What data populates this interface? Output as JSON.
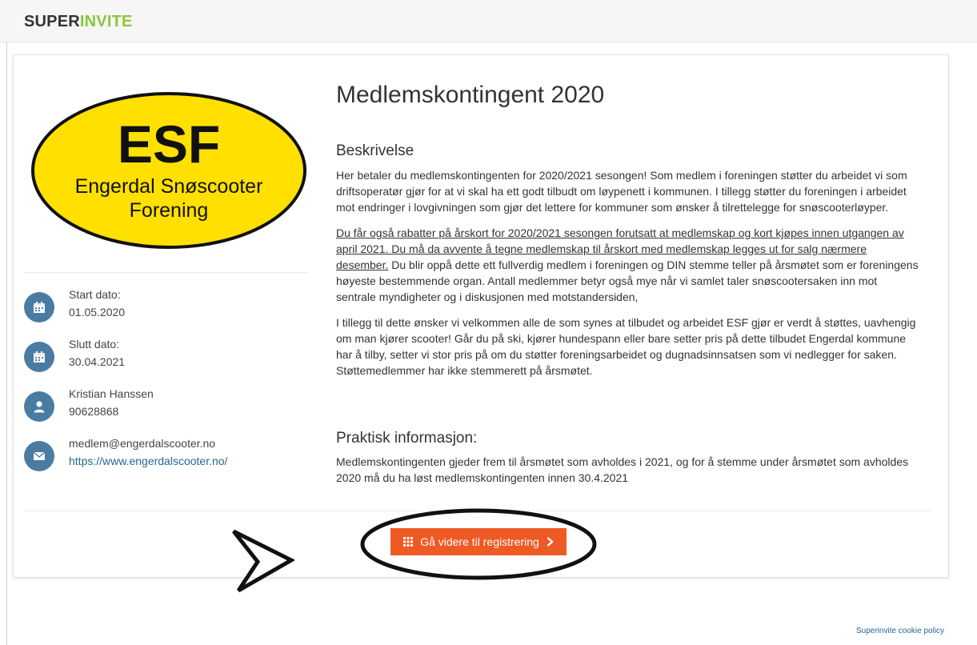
{
  "header": {
    "logo_part1": "SUPER",
    "logo_part2": "INVITE"
  },
  "colors": {
    "brand_green": "#8cc63f",
    "button_orange": "#ee5a24",
    "icon_blue": "#4a7ca3",
    "logo_yellow": "#ffe000"
  },
  "club_logo": {
    "abbr": "ESF",
    "line1": "Engerdal Snøscooter",
    "line2": "Forening"
  },
  "sidebar": {
    "start": {
      "label": "Start dato:",
      "value": "01.05.2020",
      "icon": "calendar-icon"
    },
    "end": {
      "label": "Slutt dato:",
      "value": "30.04.2021",
      "icon": "calendar-icon"
    },
    "contact": {
      "name": "Kristian Hanssen",
      "phone": "90628868",
      "icon": "user-icon"
    },
    "email": {
      "address": "medlem@engerdalscooter.no",
      "website": "https://www.engerdalscooter.no/",
      "icon": "envelope-icon"
    }
  },
  "main": {
    "title": "Medlemskontingent 2020",
    "description_heading": "Beskrivelse",
    "para1": [
      "Her betaler du medlemskontingenten for 2020/2021 sesongen! Som medlem i foreningen støtter du arbeidet vi som",
      "driftsoperatør gjør for at vi skal ha ett godt tilbudt om løypenett i kommunen. I tillegg støtter du foreningen i arbeidet",
      "mot endringer i lovgivningen som gjør det lettere for kommuner som ønsker å tilrettelegge  for snøscooterløyper."
    ],
    "para2_underlined": [
      "Du får også rabatter på årskort for 2020/2021 sesongen forutsatt at medlemskap og kort kjøpes innen utgangen av",
      "april 2021. Du må da avvente å tegne medlemskap til årskort med medlemskap legges ut for salg nærmere",
      "desember."
    ],
    "para2_rest": [
      " Du blir oppå dette ett fullverdig medlem i foreningen og DIN stemme teller på årsmøtet som er foreningens",
      "høyeste bestemmende organ. Antall medlemmer betyr også mye når vi samlet taler snøscootersaken inn mot",
      "sentrale myndigheter og i diskusjonen med motstandersiden,"
    ],
    "para3": [
      "I tillegg til dette ønsker vi velkommen alle de som synes at tilbudet og arbeidet ESF gjør er verdt å støttes, uavhengig",
      "om man kjører scooter! Går du på ski, kjører hundespann eller bare setter pris på dette tilbudet Engerdal kommune",
      "har å tilby, setter vi stor pris på om du støtter foreningsarbeidet og dugnadsinnsatsen som vi nedlegger for saken.",
      "Støttemedlemmer har ikke stemmerett på årsmøtet."
    ],
    "practical_heading": "Praktisk informasjon:",
    "practical_text": [
      "Medlemskontingenten gjeder frem til årsmøtet som avholdes i 2021, og for å stemme under årsmøtet som avholdes",
      "2020 må du ha løst medlemskontingenten innen 30.4.2021"
    ]
  },
  "cta": {
    "label": "Gå videre til registrering",
    "icon_left": "grid-icon",
    "icon_right": "chevron-right-icon"
  },
  "footer": {
    "cookie_link": "Superinvite cookie policy"
  }
}
